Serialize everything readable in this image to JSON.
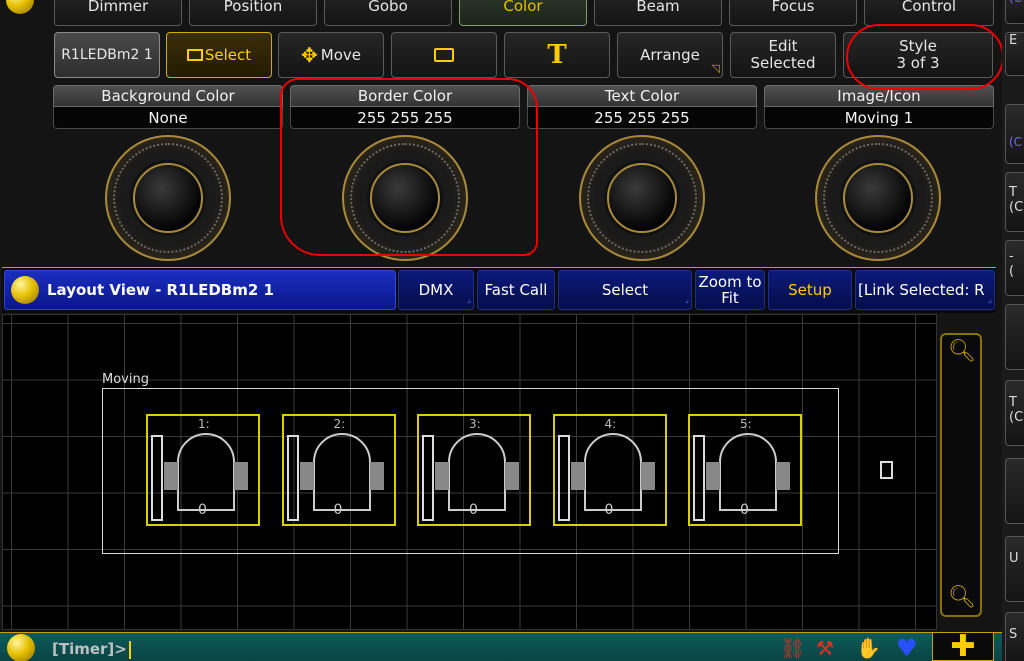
{
  "top_tabs": [
    "Dimmer",
    "Position",
    "Gobo",
    "Color",
    "Beam",
    "Focus",
    "Control"
  ],
  "toolbar": {
    "layout_name": "R1LEDBm2 1",
    "select": "Select",
    "move": "Move",
    "arrange": "Arrange",
    "edit_selected": "Edit\nSelected",
    "style_label": "Style",
    "style_value": "3 of 3"
  },
  "encoders": [
    {
      "label": "Background Color",
      "value": "None"
    },
    {
      "label": "Border Color",
      "value": "255 255 255"
    },
    {
      "label": "Text Color",
      "value": "255 255 255"
    },
    {
      "label": "Image/Icon",
      "value": "Moving 1"
    }
  ],
  "layout_view": {
    "title": "Layout View - R1LEDBm2 1",
    "buttons": [
      "DMX",
      "Fast Call",
      "Select",
      "Zoom to\nFit",
      "Setup",
      "[Link Selected: R"
    ]
  },
  "group_label": "Moving",
  "fixtures": [
    {
      "id": "1:",
      "value": "0"
    },
    {
      "id": "2:",
      "value": "0"
    },
    {
      "id": "3:",
      "value": "0"
    },
    {
      "id": "4:",
      "value": "0"
    },
    {
      "id": "5:",
      "value": "0"
    }
  ],
  "right_strip": [
    "(C",
    "E",
    "(C",
    "T\n(C",
    "-\n(",
    "T\n(C",
    "U",
    "S"
  ],
  "command_line": "[Timer]>",
  "colors": {
    "accent": "#c8a000",
    "layout_blue": "#1b2fc0",
    "fixture_border": "#d8d000",
    "annotation": "#e00000"
  }
}
